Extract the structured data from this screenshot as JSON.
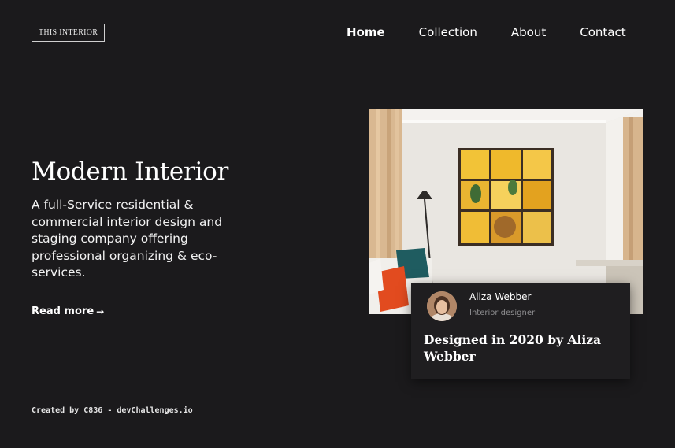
{
  "header": {
    "logo": "THIS INTERIOR",
    "nav": [
      {
        "label": "Home",
        "active": true
      },
      {
        "label": "Collection",
        "active": false
      },
      {
        "label": "About",
        "active": false
      },
      {
        "label": "Contact",
        "active": false
      }
    ]
  },
  "hero": {
    "title": "Modern Interior",
    "description": "A full-Service residential & commercial interior design and staging company offering professional organizing & eco-services.",
    "read_more_label": "Read more",
    "read_more_icon": "arrow-right-icon"
  },
  "feature_image": {
    "subject": "room-photo"
  },
  "designer_card": {
    "name": "Aliza Webber",
    "role": "Interior designer",
    "headline": "Designed in 2020 by Aliza Webber",
    "avatar": "avatar-photo"
  },
  "footer": {
    "credit": "Created by C836 - devChallenges.io"
  },
  "colors": {
    "background": "#1b1a1c",
    "card": "#1f1e20",
    "text": "#ffffff",
    "muted": "#8d8d8f"
  }
}
